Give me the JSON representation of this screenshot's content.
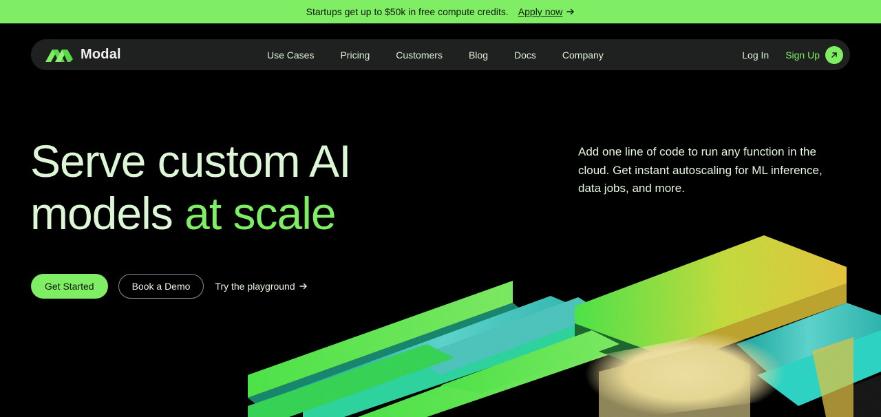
{
  "announcement": {
    "text": "Startups get up to $50k in free compute credits.",
    "link_label": "Apply now"
  },
  "nav": {
    "brand": "Modal",
    "links": [
      "Use Cases",
      "Pricing",
      "Customers",
      "Blog",
      "Docs",
      "Company"
    ],
    "login": "Log In",
    "signup": "Sign Up"
  },
  "hero": {
    "title_line1": "Serve custom AI",
    "title_line2_plain": "models ",
    "title_line2_accent": "at scale",
    "description": "Add one line of code to run any function in the cloud. Get instant autoscaling for ML inference, data jobs, and more.",
    "cta_primary": "Get Started",
    "cta_secondary": "Book a Demo",
    "cta_link": "Try the playground"
  },
  "colors": {
    "accent": "#7fee64",
    "background": "#000000",
    "navbar": "#1f2120",
    "text": "#ddf7d6"
  }
}
